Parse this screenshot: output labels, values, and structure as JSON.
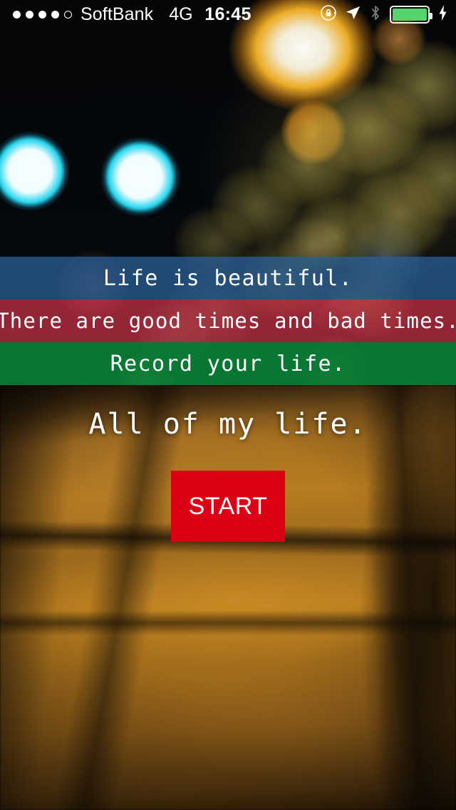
{
  "status_bar": {
    "signal_dots_filled": 4,
    "signal_dots_total": 5,
    "carrier": "SoftBank",
    "network": "4G",
    "time": "16:45",
    "icons": [
      "rotation-lock-icon",
      "location-arrow-icon",
      "bluetooth-icon",
      "battery-icon",
      "charging-bolt-icon"
    ],
    "battery_color": "#53d56c",
    "battery_level_percent": 100
  },
  "bands": [
    {
      "text": "Life is beautiful.",
      "color": "#4a7398",
      "name": "blue"
    },
    {
      "text": "There are good times and bad times.",
      "color": "#e86f80",
      "name": "red"
    },
    {
      "text": "Record your life.",
      "color": "#17863f",
      "name": "green"
    }
  ],
  "main": {
    "tagline": "All of my life.",
    "start_label": "START",
    "start_color": "#dd0116"
  }
}
